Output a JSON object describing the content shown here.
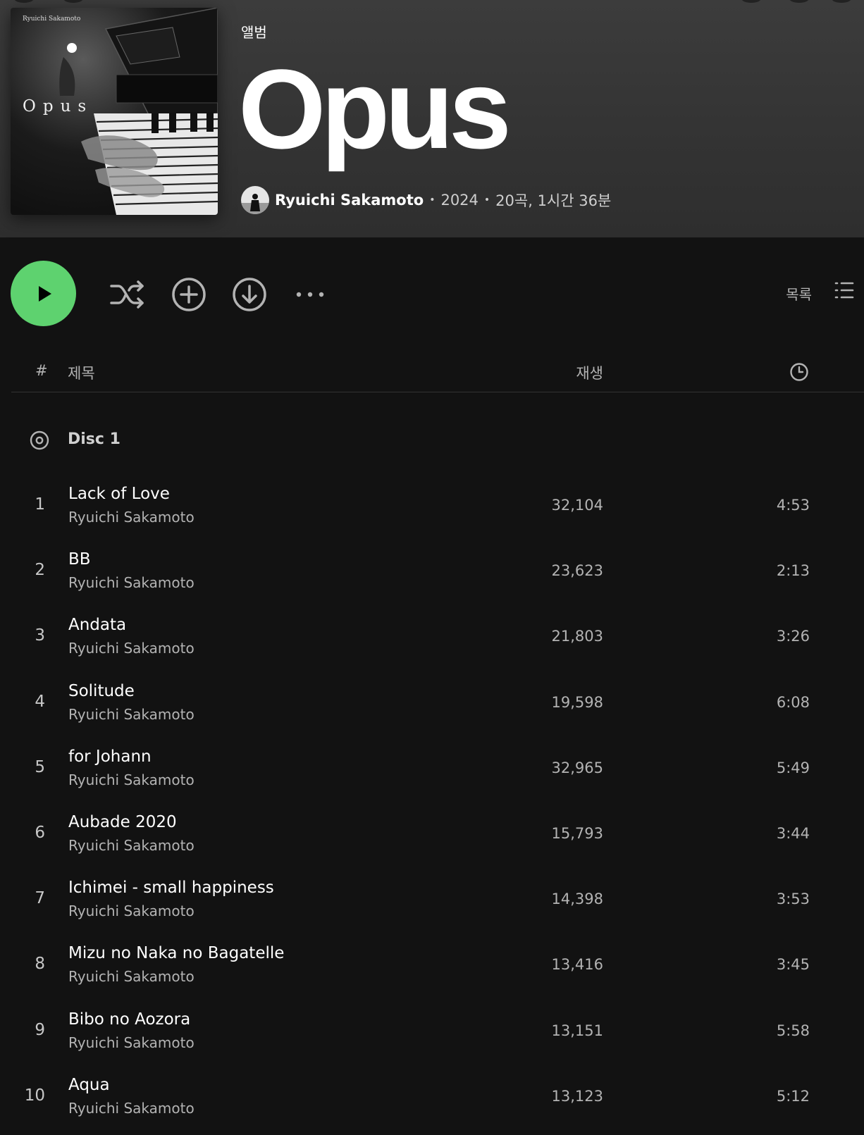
{
  "album": {
    "cover_credit": "Ryuichi Sakamoto",
    "cover_title": "Opus",
    "type_label": "앨범",
    "title": "Opus",
    "artist": "Ryuichi Sakamoto",
    "year": "2024",
    "summary": "20곡, 1시간 36분",
    "separator": "•"
  },
  "controls": {
    "play_icon": "play-icon",
    "shuffle_icon": "shuffle-icon",
    "add_icon": "add-circle-icon",
    "download_icon": "download-icon",
    "more_icon": "more-icon",
    "view_label": "목록",
    "view_icon": "list-view-icon",
    "accent_color": "#5ed26f"
  },
  "table_header": {
    "number": "#",
    "title": "제목",
    "plays": "재생",
    "duration_icon": "clock-icon"
  },
  "disc": {
    "label": "Disc 1",
    "icon": "disc-icon"
  },
  "tracks": [
    {
      "num": "1",
      "title": "Lack of Love",
      "artist": "Ryuichi Sakamoto",
      "plays": "32,104",
      "duration": "4:53"
    },
    {
      "num": "2",
      "title": "BB",
      "artist": "Ryuichi Sakamoto",
      "plays": "23,623",
      "duration": "2:13"
    },
    {
      "num": "3",
      "title": "Andata",
      "artist": "Ryuichi Sakamoto",
      "plays": "21,803",
      "duration": "3:26"
    },
    {
      "num": "4",
      "title": "Solitude",
      "artist": "Ryuichi Sakamoto",
      "plays": "19,598",
      "duration": "6:08"
    },
    {
      "num": "5",
      "title": "for Johann",
      "artist": "Ryuichi Sakamoto",
      "plays": "32,965",
      "duration": "5:49"
    },
    {
      "num": "6",
      "title": "Aubade 2020",
      "artist": "Ryuichi Sakamoto",
      "plays": "15,793",
      "duration": "3:44"
    },
    {
      "num": "7",
      "title": "Ichimei - small happiness",
      "artist": "Ryuichi Sakamoto",
      "plays": "14,398",
      "duration": "3:53"
    },
    {
      "num": "8",
      "title": "Mizu no Naka no Bagatelle",
      "artist": "Ryuichi Sakamoto",
      "plays": "13,416",
      "duration": "3:45"
    },
    {
      "num": "9",
      "title": "Bibo no Aozora",
      "artist": "Ryuichi Sakamoto",
      "plays": "13,151",
      "duration": "5:58"
    },
    {
      "num": "10",
      "title": "Aqua",
      "artist": "Ryuichi Sakamoto",
      "plays": "13,123",
      "duration": "5:12"
    }
  ]
}
